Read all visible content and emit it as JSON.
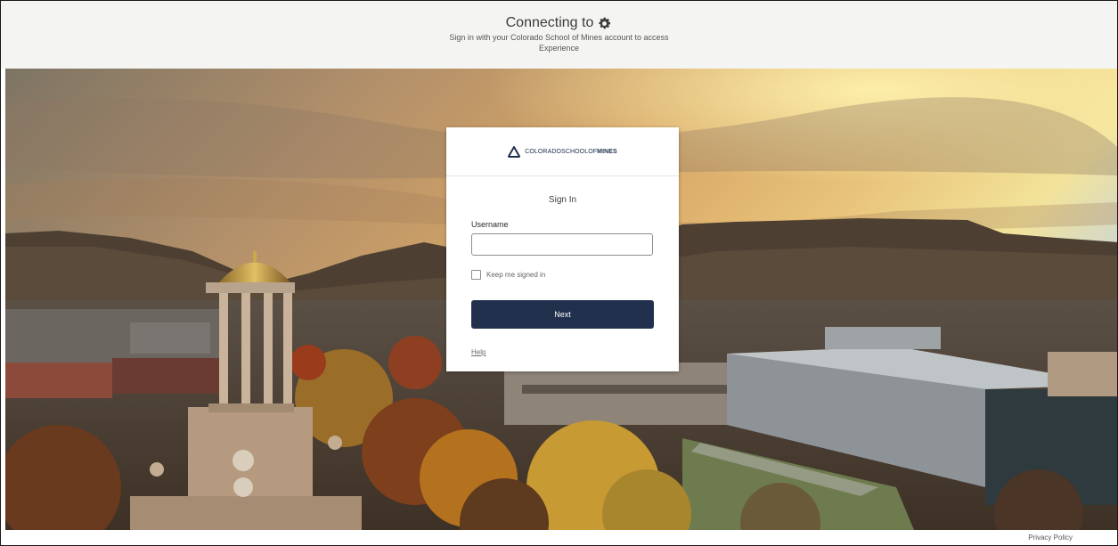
{
  "header": {
    "title": "Connecting to",
    "icon": "gear-icon",
    "subtitle_line1": "Sign in with your Colorado School of Mines account to access",
    "subtitle_line2": "Experience"
  },
  "card": {
    "logo": {
      "icon": "mines-triangle-logo-icon",
      "text_regular": "COLORADOSCHOOLOF",
      "text_bold": "MINES"
    },
    "title": "Sign In",
    "username_label": "Username",
    "username_value": "",
    "username_placeholder": "",
    "keep_signed_in_label": "Keep me signed in",
    "keep_signed_in_checked": false,
    "next_label": "Next",
    "help_label": "Help"
  },
  "footer": {
    "privacy_label": "Privacy Policy"
  },
  "colors": {
    "primary_button": "#21314d",
    "header_bg": "#f4f4f2",
    "card_bg": "#ffffff"
  }
}
